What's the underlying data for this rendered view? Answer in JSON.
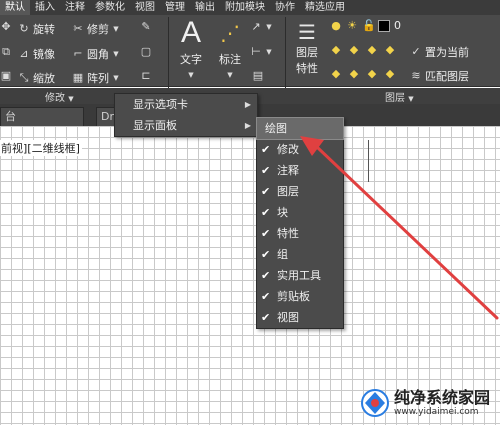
{
  "tabs": [
    "默认",
    "插入",
    "注释",
    "参数化",
    "视图",
    "管理",
    "输出",
    "附加模块",
    "协作",
    "精选应用"
  ],
  "ribbon": {
    "modify": {
      "rotate": "旋转",
      "trim": "修剪",
      "mirror": "镜像",
      "fillet": "圆角",
      "scale": "缩放",
      "array": "阵列"
    },
    "annotation": {
      "text": "文字",
      "dimension": "标注"
    },
    "layers": {
      "layer_prop_line1": "图层",
      "layer_prop_line2": "特性",
      "current_layer_value": "0",
      "make_current": "置为当前",
      "match_layer": "匹配图层"
    }
  },
  "panel_titles": {
    "modify": "修改",
    "layers": "图层"
  },
  "file_tabs": [
    "台",
    "Dr"
  ],
  "view_label": "前视][二维线框]",
  "context_menu": {
    "items": [
      {
        "label": "显示选项卡"
      },
      {
        "label": "显示面板"
      }
    ]
  },
  "submenu": {
    "items": [
      {
        "label": "绘图",
        "checked": false,
        "highlighted": true
      },
      {
        "label": "修改",
        "checked": true
      },
      {
        "label": "注释",
        "checked": true
      },
      {
        "label": "图层",
        "checked": true
      },
      {
        "label": "块",
        "checked": true
      },
      {
        "label": "特性",
        "checked": true
      },
      {
        "label": "组",
        "checked": true
      },
      {
        "label": "实用工具",
        "checked": true
      },
      {
        "label": "剪贴板",
        "checked": true
      },
      {
        "label": "视图",
        "checked": true
      }
    ]
  },
  "watermark": {
    "title": "纯净系统家园",
    "url": "www.yidaimei.com"
  },
  "colors": {
    "ribbon_bg": "#4a4a4a",
    "tab_bar_bg": "#3b3b3b",
    "menu_bg": "#4b4b4b",
    "annotation_arrow": "#e04040",
    "grid_line": "#c9c9c9"
  }
}
